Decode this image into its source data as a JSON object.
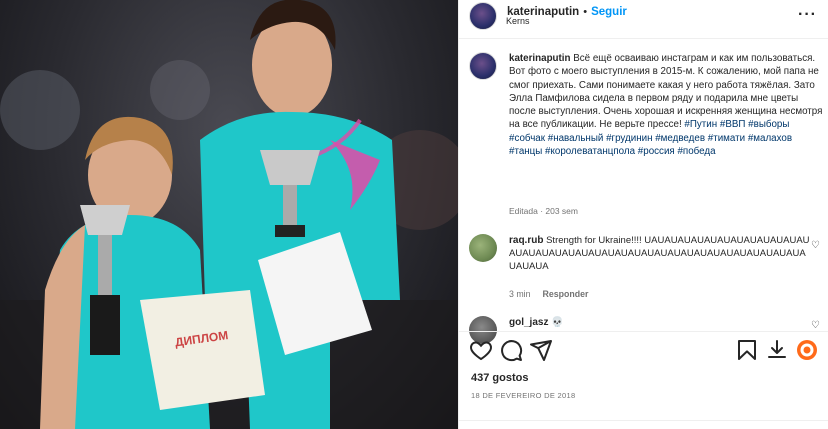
{
  "post": {
    "username": "katerinaputin",
    "dot": "•",
    "follow_label": "Seguir",
    "location": "Kerns",
    "more_label": "···"
  },
  "caption": {
    "username": "katerinaputin",
    "text": "Всё ещё осваиваю инстаграм и как им пользоваться. Вот фото с моего выступления в 2015-м. К сожалению, мой папа не смог приехать. Сами понимаете какая у него работа тяжёлая. Зато Элла Памфилова сидела в первом ряду и подарила мне цветы после выступления. Очень хорошая и искренняя женщина несмотря на все публикации. Не верьте прессе!",
    "hashtags": "#Путин #ВВП #выборы #собчак #навальный #грудинин #медведев #тимати #малахов #танцы #королеватанцпола #россия #победа",
    "edited": "Editada · 203 sem"
  },
  "comments": [
    {
      "username": "raq.rub",
      "text": "Strength for Ukraine!!!! UAUAUAUAUAUAUAUAUAUAUAUAUAUAUAUAUAUAUAUAUAUAUAUAUAUAUAUAUAUAUAUAUAUAUAUAUAUA",
      "time": "3 min",
      "reply_label": "Responder"
    },
    {
      "username": "gol_jasz 💀",
      "text": ""
    }
  ],
  "footer": {
    "likes": "437 gostos",
    "date": "18 DE FEVEREIRO DE 2018"
  },
  "icons": {
    "like": "heart-icon",
    "comment": "comment-icon",
    "share": "share-icon",
    "save": "bookmark-icon",
    "download": "download-icon",
    "extension": "extension-icon"
  },
  "colors": {
    "link": "#0095f6",
    "hashtag": "#00376b",
    "muted": "#737373",
    "costume": "#1fc7c9"
  }
}
